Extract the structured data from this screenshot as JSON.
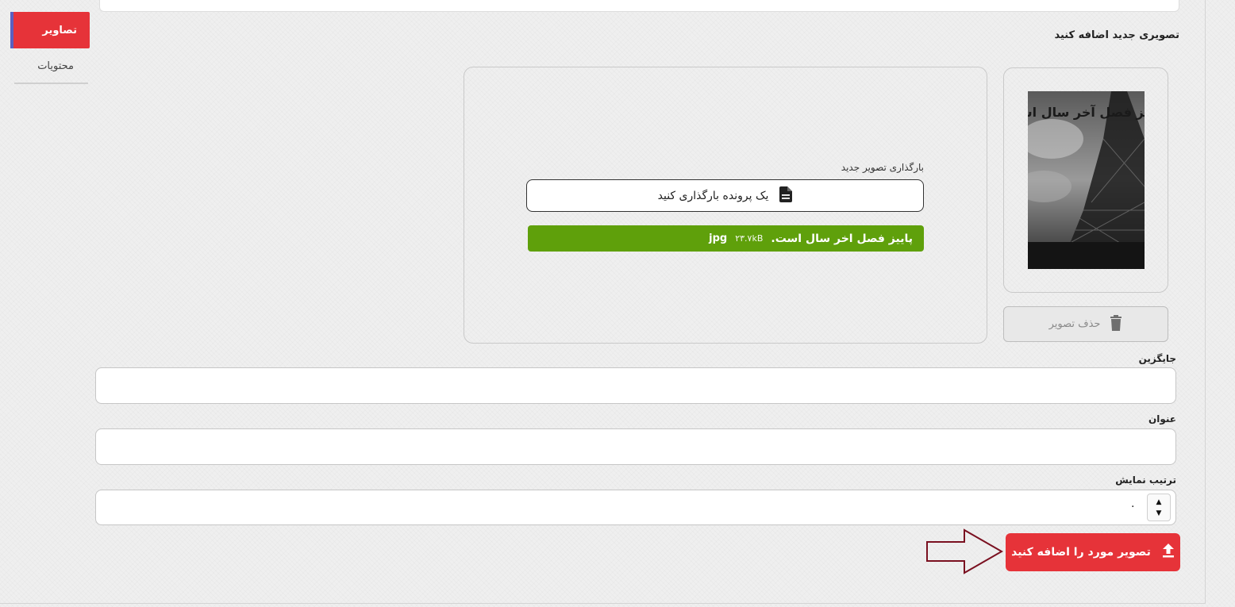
{
  "tabs": [
    {
      "label": "تصاویر",
      "active": true
    },
    {
      "label": "محتویات",
      "active": false
    }
  ],
  "section_title": "تصویری جدید اضافه کنید",
  "preview": {
    "image_text": "پاییز فصل آخر سال است",
    "delete_label": "حذف تصویر",
    "delete_icon": "trash-icon"
  },
  "upload": {
    "label": "بارگذاری تصویر جدید",
    "button_label": "یک پرونده بارگذاری کنید",
    "button_icon": "file-icon",
    "file": {
      "name": "پاییز فصل اخر سال است.",
      "size": "۲۳.۷kB",
      "extension": "jpg"
    }
  },
  "fields": {
    "alt_label": "جایگزین",
    "alt_value": "",
    "title_label": "عنوان",
    "title_value": "",
    "order_label": "ترتیب نمایش",
    "order_value": "۰"
  },
  "submit": {
    "label": "تصویر مورد را اضافه کنید",
    "icon": "upload-icon"
  },
  "colors": {
    "accent": "#e63339",
    "success": "#5fa00b",
    "annotation_arrow": "#7a1020"
  }
}
